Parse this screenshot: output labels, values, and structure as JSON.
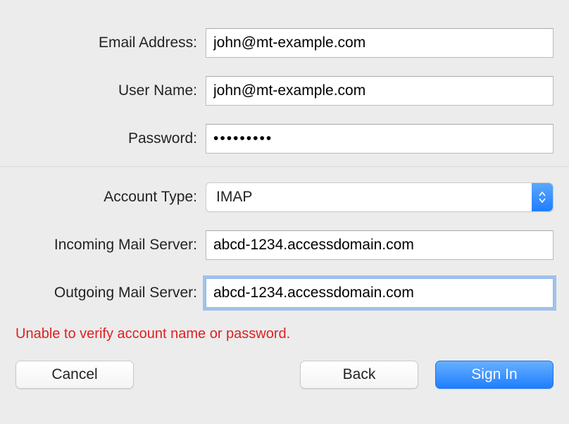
{
  "labels": {
    "email": "Email Address:",
    "username": "User Name:",
    "password": "Password:",
    "account_type": "Account Type:",
    "incoming": "Incoming Mail Server:",
    "outgoing": "Outgoing Mail Server:"
  },
  "values": {
    "email": "john@mt-example.com",
    "username": "john@mt-example.com",
    "password": "•••••••••",
    "account_type": "IMAP",
    "incoming": "abcd-1234.accessdomain.com",
    "outgoing": "abcd-1234.accessdomain.com"
  },
  "error": "Unable to verify account name or password.",
  "buttons": {
    "cancel": "Cancel",
    "back": "Back",
    "signin": "Sign In"
  }
}
